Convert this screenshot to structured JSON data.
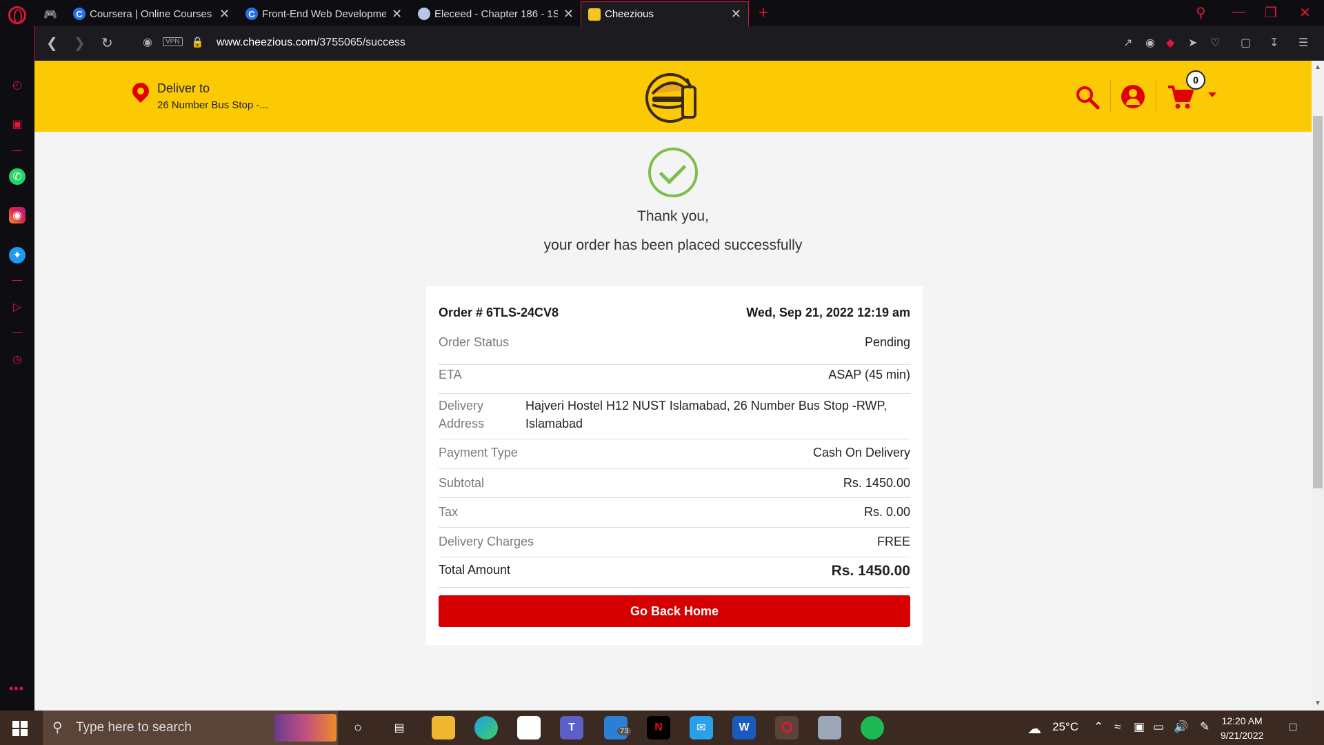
{
  "browser": {
    "tabs": [
      {
        "title": "Coursera | Online Courses &",
        "favicon": "coursera-icon"
      },
      {
        "title": "Front-End Web Developme",
        "favicon": "coursera-icon"
      },
      {
        "title": "Eleceed - Chapter 186 - 1S",
        "favicon": "moon-icon"
      },
      {
        "title": "Cheezious",
        "favicon": "cheezious-icon",
        "active": true
      }
    ],
    "vpn_label": "VPN",
    "url_domain": "www.cheezious.com",
    "url_path": "/3755065/success"
  },
  "header": {
    "deliver_label": "Deliver to",
    "deliver_address": "26 Number Bus Stop -...",
    "cart_count": "0"
  },
  "confirmation": {
    "line1": "Thank you,",
    "line2": "your order has been placed successfully"
  },
  "order": {
    "number": "Order # 6TLS-24CV8",
    "datetime": "Wed, Sep 21, 2022 12:19 am",
    "rows": [
      {
        "label": "Order Status",
        "value": "Pending"
      },
      {
        "label": "ETA",
        "value": "ASAP (45 min)"
      },
      {
        "label": "Delivery Address",
        "value": "Hajveri Hostel H12 NUST Islamabad, 26 Number Bus Stop -RWP, Islamabad"
      },
      {
        "label": "Payment Type",
        "value": "Cash On Delivery"
      },
      {
        "label": "Subtotal",
        "value": "Rs. 1450.00"
      },
      {
        "label": "Tax",
        "value": "Rs. 0.00"
      },
      {
        "label": "Delivery Charges",
        "value": "FREE"
      },
      {
        "label": "Total Amount",
        "value": "Rs. 1450.00"
      }
    ],
    "button_label": "Go Back Home"
  },
  "taskbar": {
    "search_placeholder": "Type here to search",
    "badge_count": "73",
    "weather": "25°C",
    "time": "12:20 AM",
    "date": "9/21/2022"
  },
  "colors": {
    "brand_yellow": "#fcca05",
    "brand_red": "#d60000",
    "success_green": "#7cc04b",
    "opera_red": "#e0153a"
  }
}
